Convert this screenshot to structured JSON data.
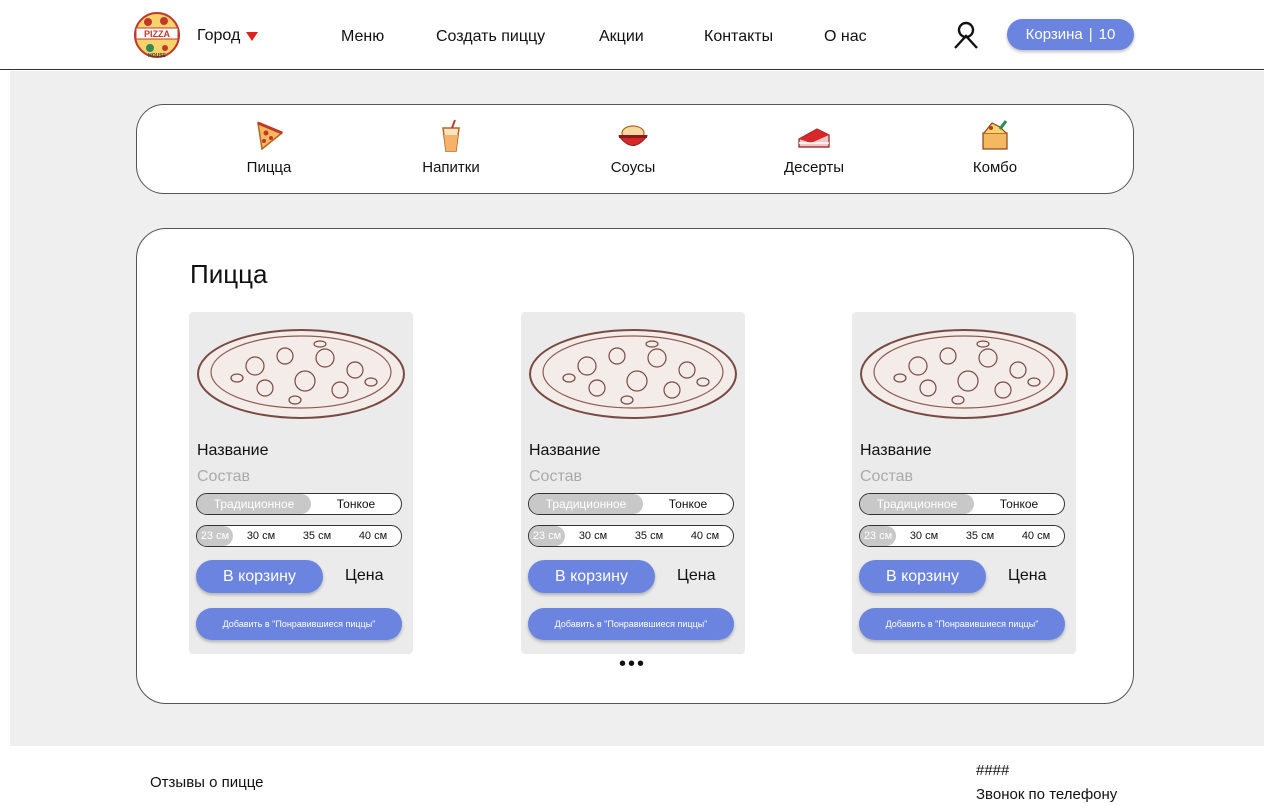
{
  "header": {
    "logo_text_top": "PIZZA",
    "logo_text_bottom": "HOUSE",
    "city_label": "Город",
    "nav": [
      "Меню",
      "Создать пиццу",
      "Акции",
      "Контакты",
      "О нас"
    ],
    "cart_label": "Корзина",
    "cart_separator": "|",
    "cart_count": "10",
    "accent_color": "#6a84e0"
  },
  "categories": [
    {
      "label": "Пицца",
      "icon": "pizza-slice-icon"
    },
    {
      "label": "Напитки",
      "icon": "drink-cup-icon"
    },
    {
      "label": "Соусы",
      "icon": "sauce-bowl-icon"
    },
    {
      "label": "Десерты",
      "icon": "cake-slice-icon"
    },
    {
      "label": "Комбо",
      "icon": "combo-box-icon"
    }
  ],
  "section": {
    "title": "Пицца",
    "more": "•••",
    "cards": [
      {
        "name": "Название",
        "composition": "Состав",
        "dough": [
          "Традиционное",
          "Тонкое"
        ],
        "sizes": [
          "23 см",
          "30 см",
          "35 см",
          "40 см"
        ],
        "cart_button": "В корзину",
        "price": "Цена",
        "fav_button": "Добавить в \"Понравившиеся пиццы\""
      },
      {
        "name": "Название",
        "composition": "Состав",
        "dough": [
          "Традиционное",
          "Тонкое"
        ],
        "sizes": [
          "23 см",
          "30 см",
          "35 см",
          "40 см"
        ],
        "cart_button": "В корзину",
        "price": "Цена",
        "fav_button": "Добавить в \"Понравившиеся пиццы\""
      },
      {
        "name": "Название",
        "composition": "Состав",
        "dough": [
          "Традиционное",
          "Тонкое"
        ],
        "sizes": [
          "23 см",
          "30 см",
          "35 см",
          "40 см"
        ],
        "cart_button": "В корзину",
        "price": "Цена",
        "fav_button": "Добавить в \"Понравившиеся пиццы\""
      }
    ]
  },
  "footer": {
    "reviews": "Отзывы о пицце",
    "phone": "####",
    "call": "Звонок по телефону"
  }
}
